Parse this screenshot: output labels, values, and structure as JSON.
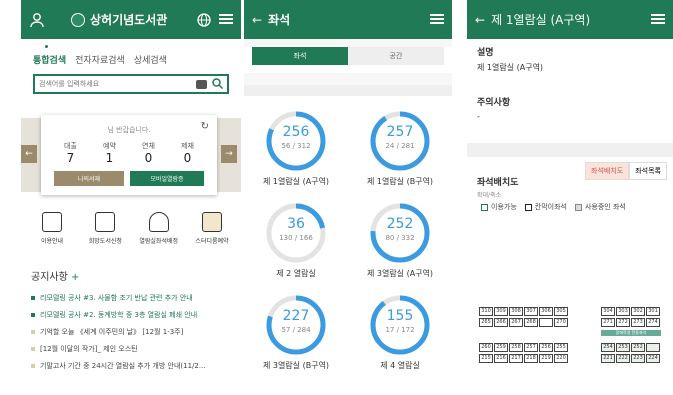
{
  "p1": {
    "title": "상허기념도서관",
    "tabs": [
      "통합검색",
      "전자자료검색",
      "상세검색"
    ],
    "search_placeholder": "검색어를 입력하세요",
    "greeting": "님 반갑습니다.",
    "stats": [
      {
        "label": "대출",
        "value": "7"
      },
      {
        "label": "예약",
        "value": "1"
      },
      {
        "label": "연체",
        "value": "0"
      },
      {
        "label": "제재",
        "value": "0"
      }
    ],
    "btn_mylib": "나의서재",
    "btn_mobile": "모바일열람증",
    "quick": [
      "이용안내",
      "희망도서신청",
      "열람실좌석배정",
      "스터디룸예약"
    ],
    "notice_title": "공지사항",
    "notice_plus": "+",
    "notices": [
      "리모델링 공사 #3. 사물함 조기 반납 관련 추가 안내",
      "리모델링 공사 #2. 동계방학 중 3층 열람실 폐쇄 안내",
      "기억할 오늘 《세계 이주민의 날》 [12월 1-3주]",
      "[12월 이달의 작가]_ 제인 오스틴",
      "기말고사 기간 중 24시간 열람실 추가 개방 안내(11/2..."
    ]
  },
  "p2": {
    "title": "좌석",
    "tab_seat": "좌석",
    "tab_space": "공간",
    "rooms": [
      {
        "avail": "256",
        "used": "56",
        "total": "312",
        "name": "제 1열람실 (A구역)",
        "fraction": 0.82
      },
      {
        "avail": "257",
        "used": "24",
        "total": "281",
        "name": "제 1열람실 (B구역)",
        "fraction": 0.91
      },
      {
        "avail": "36",
        "used": "130",
        "total": "166",
        "name": "제 2 열람실",
        "fraction": 0.22
      },
      {
        "avail": "252",
        "used": "80",
        "total": "332",
        "name": "제 3열람실 (A구역)",
        "fraction": 0.76
      },
      {
        "avail": "227",
        "used": "57",
        "total": "284",
        "name": "제 3열람실 (B구역)",
        "fraction": 0.8
      },
      {
        "avail": "155",
        "used": "17",
        "total": "172",
        "name": "제 4 열람실",
        "fraction": 0.9
      }
    ]
  },
  "p3": {
    "title": "제 1열람실 (A구역)",
    "desc_head": "설명",
    "desc": "제 1열람실 (A구역)",
    "caution_head": "주의사항",
    "caution": "-",
    "layout_head": "좌석배치도",
    "zoom_hint": "확대/축소",
    "seg_layout": "좌석배치도",
    "seg_list": "좌석목록",
    "legend": [
      "이용가능",
      "칸막이좌석",
      "사용중인 좌석"
    ],
    "left_seats": [
      [
        "310",
        "309",
        "308",
        "307",
        "306",
        "305"
      ],
      [
        "265",
        "266",
        "267",
        "268",
        "",
        "270"
      ],
      [
        "260",
        "259",
        "258",
        "257",
        "256",
        "255"
      ],
      [
        "215",
        "216",
        "217",
        "218",
        "219",
        "220"
      ]
    ],
    "right_seats": [
      [
        "304",
        "303",
        "302",
        "301"
      ],
      [
        "271",
        "272",
        "273",
        "274"
      ],
      [
        "254",
        "253",
        "252",
        ""
      ],
      [
        "221",
        "222",
        "223",
        "224"
      ]
    ],
    "right_label": "장애학생 전용좌석"
  },
  "colors": {
    "brand": "#1f7a55",
    "ring": "#3a9be0",
    "gold": "#9b8b6c"
  }
}
